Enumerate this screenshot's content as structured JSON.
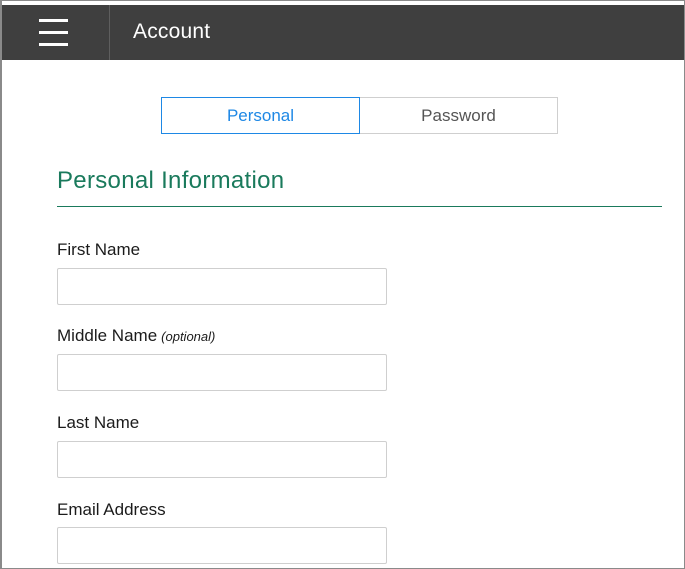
{
  "header": {
    "title": "Account"
  },
  "tabs": [
    {
      "label": "Personal",
      "active": true
    },
    {
      "label": "Password",
      "active": false
    }
  ],
  "section": {
    "title": "Personal Information"
  },
  "fields": {
    "first_name": {
      "label": "First Name",
      "value": ""
    },
    "middle_name": {
      "label": "Middle Name",
      "hint": "(optional)",
      "value": ""
    },
    "last_name": {
      "label": "Last Name",
      "value": ""
    },
    "email": {
      "label": "Email Address",
      "value": ""
    }
  },
  "colors": {
    "topbar": "#3f3f3f",
    "accent_blue": "#1e88e5",
    "section_green": "#1a7a5c"
  },
  "icons": {
    "menu": "hamburger-menu-icon"
  }
}
